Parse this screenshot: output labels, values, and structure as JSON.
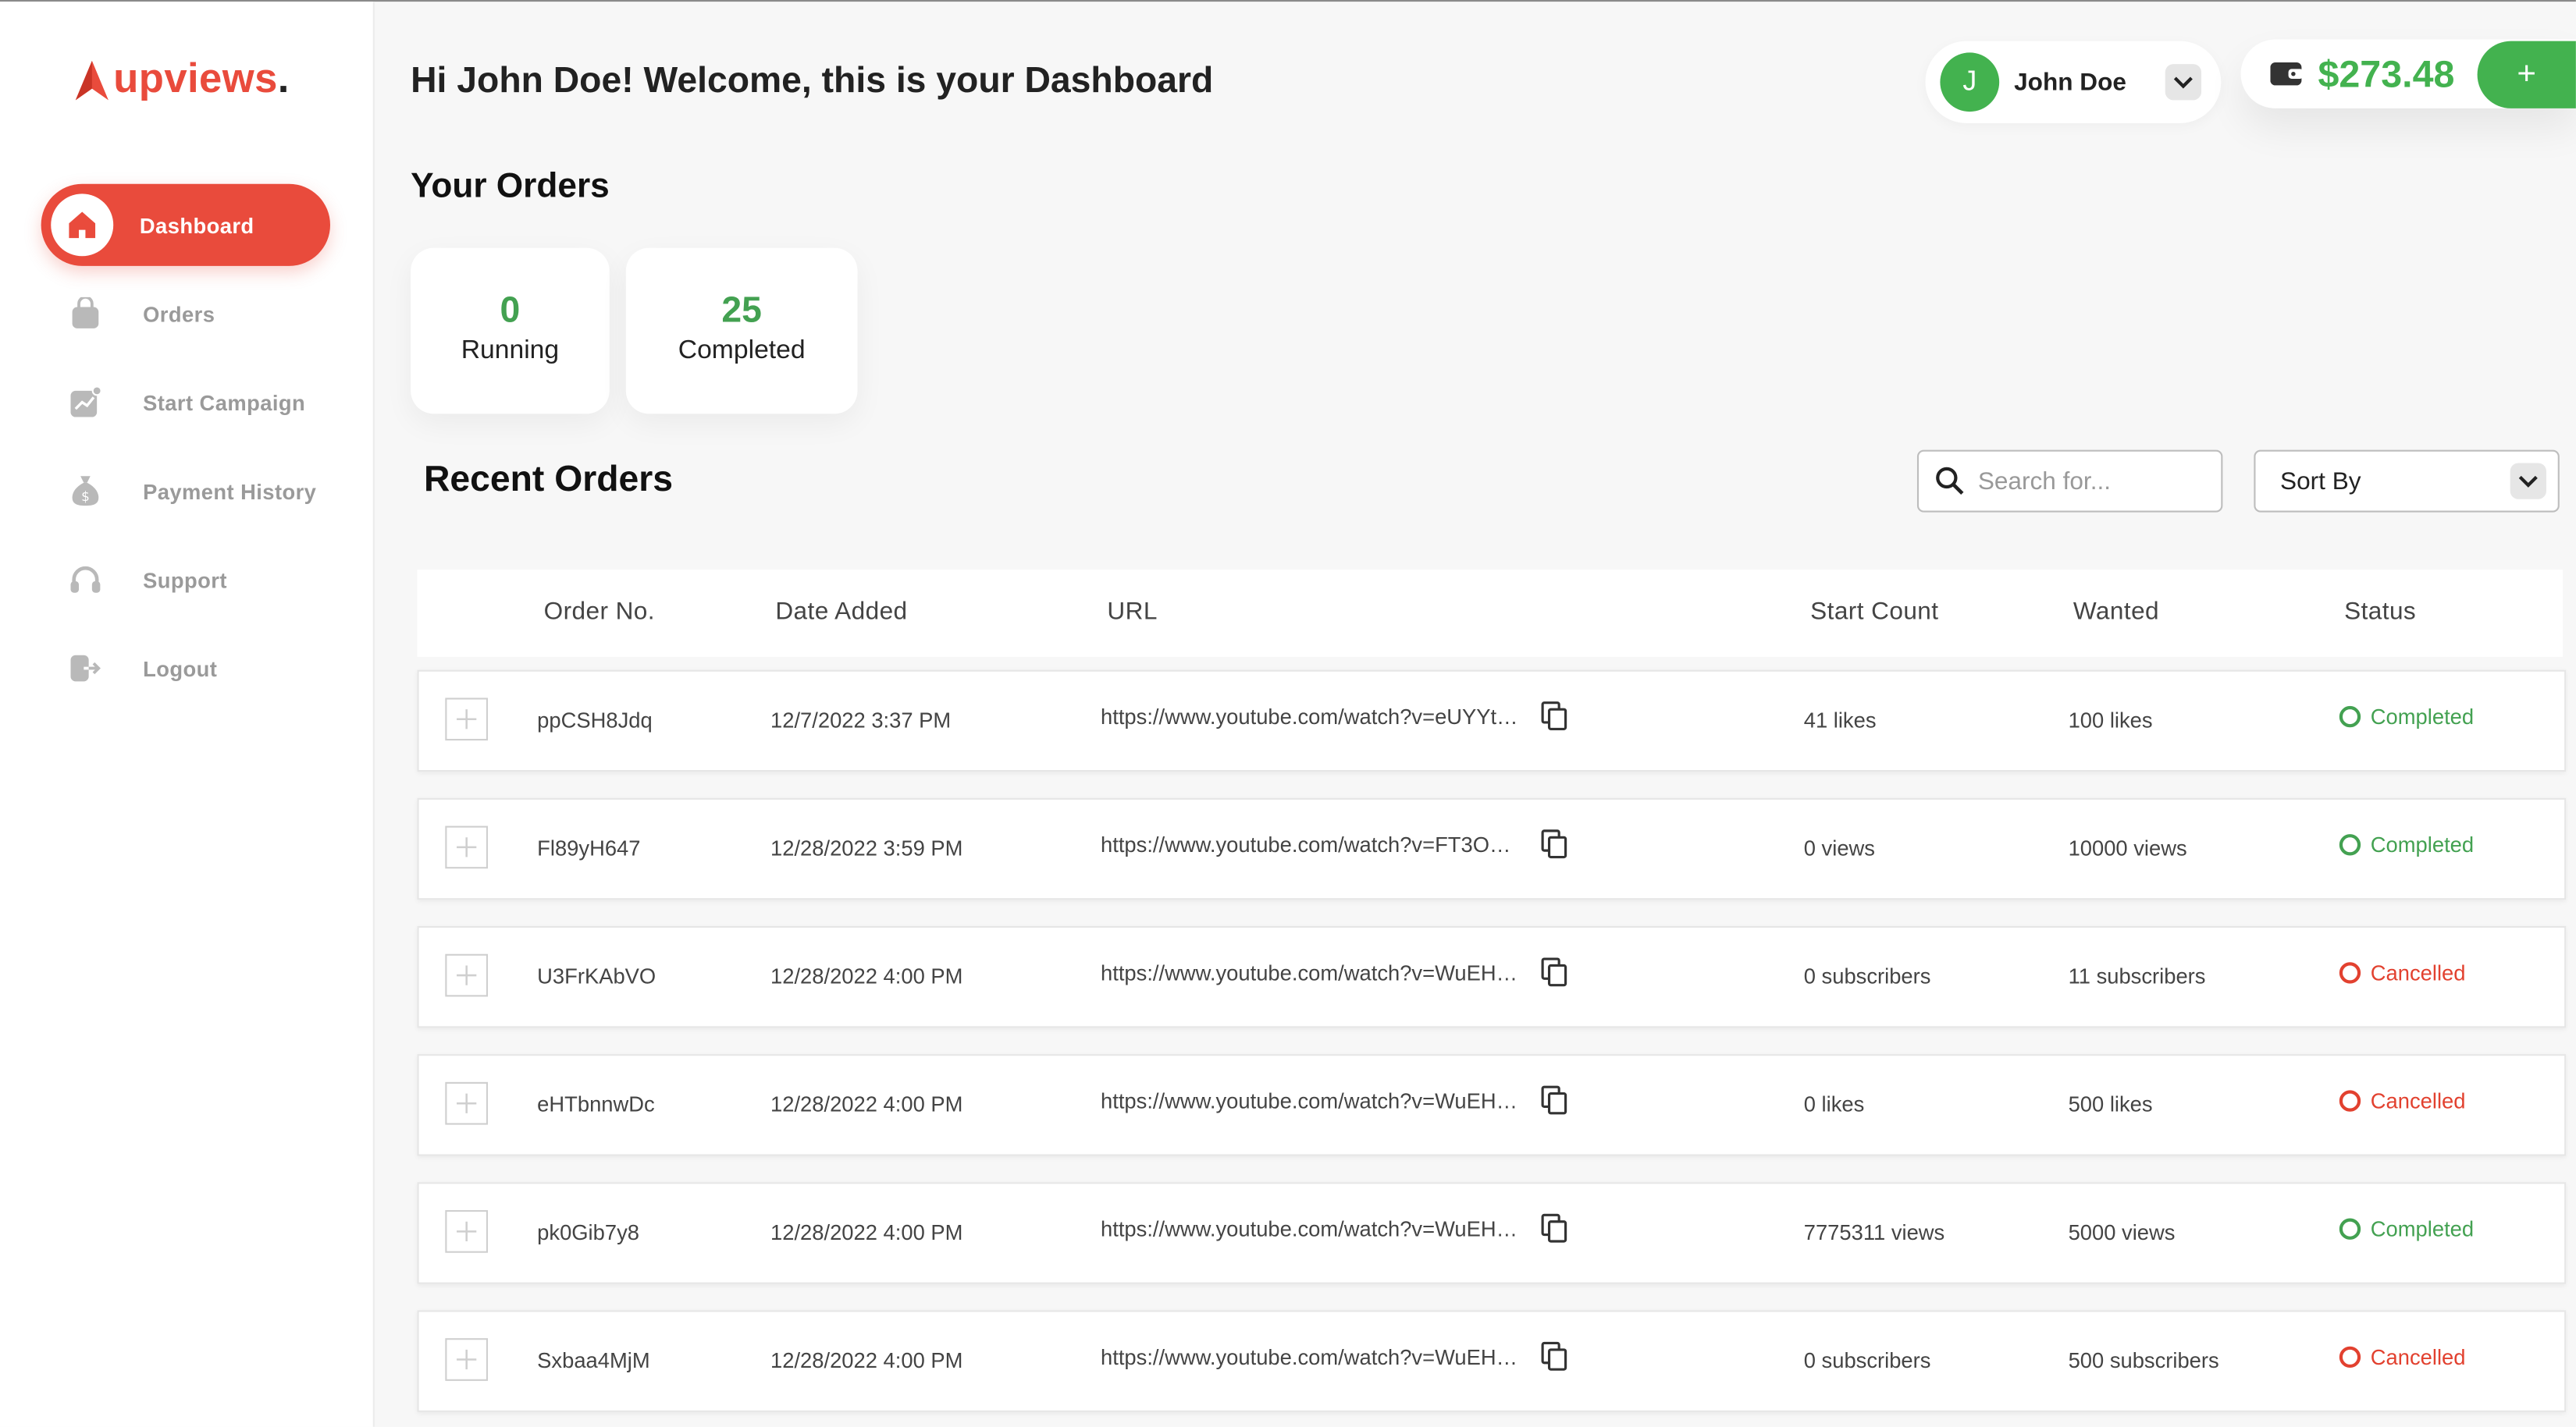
{
  "brand": {
    "logo_text": "upviews",
    "logo_dot": "."
  },
  "sidebar": {
    "items": [
      {
        "label": "Dashboard",
        "icon": "home-icon",
        "active": true
      },
      {
        "label": "Orders",
        "icon": "bag-icon"
      },
      {
        "label": "Start Campaign",
        "icon": "chart-icon"
      },
      {
        "label": "Payment History",
        "icon": "money-bag-icon"
      },
      {
        "label": "Support",
        "icon": "headset-icon"
      },
      {
        "label": "Logout",
        "icon": "logout-icon"
      }
    ]
  },
  "header": {
    "welcome": "Hi John Doe! Welcome, this is your Dashboard",
    "user": {
      "initial": "J",
      "name": "John Doe"
    },
    "wallet": {
      "balance": "$273.48",
      "add_label": "+"
    }
  },
  "your_orders": {
    "title": "Your Orders",
    "running": {
      "value": "0",
      "label": "Running"
    },
    "completed": {
      "value": "25",
      "label": "Completed"
    }
  },
  "recent": {
    "title": "Recent Orders",
    "search_placeholder": "Search for...",
    "sort_label": "Sort By",
    "columns": [
      "Order No.",
      "Date Added",
      "URL",
      "Start Count",
      "Wanted",
      "Status"
    ],
    "rows": [
      {
        "order": "ppCSH8Jdq",
        "date": "12/7/2022 3:37 PM",
        "url": "https://www.youtube.com/watch?v=eUYYt…",
        "start": "41 likes",
        "wanted": "100 likes",
        "status": "Completed"
      },
      {
        "order": "Fl89yH647",
        "date": "12/28/2022 3:59 PM",
        "url": "https://www.youtube.com/watch?v=FT3O…",
        "start": "0 views",
        "wanted": "10000 views",
        "status": "Completed"
      },
      {
        "order": "U3FrKAbVO",
        "date": "12/28/2022 4:00 PM",
        "url": "https://www.youtube.com/watch?v=WuEH…",
        "start": "0 subscribers",
        "wanted": "11 subscribers",
        "status": "Cancelled"
      },
      {
        "order": "eHTbnnwDc",
        "date": "12/28/2022 4:00 PM",
        "url": "https://www.youtube.com/watch?v=WuEH…",
        "start": "0 likes",
        "wanted": "500 likes",
        "status": "Cancelled"
      },
      {
        "order": "pk0Gib7y8",
        "date": "12/28/2022 4:00 PM",
        "url": "https://www.youtube.com/watch?v=WuEH…",
        "start": "7775311 views",
        "wanted": "5000 views",
        "status": "Completed"
      },
      {
        "order": "Sxbaa4MjM",
        "date": "12/28/2022 4:00 PM",
        "url": "https://www.youtube.com/watch?v=WuEH…",
        "start": "0 subscribers",
        "wanted": "500 subscribers",
        "status": "Cancelled"
      }
    ]
  },
  "colors": {
    "accent": "#e94b3c",
    "success": "#43a151",
    "danger": "#e2412f",
    "wallet_green": "#43b24f"
  }
}
